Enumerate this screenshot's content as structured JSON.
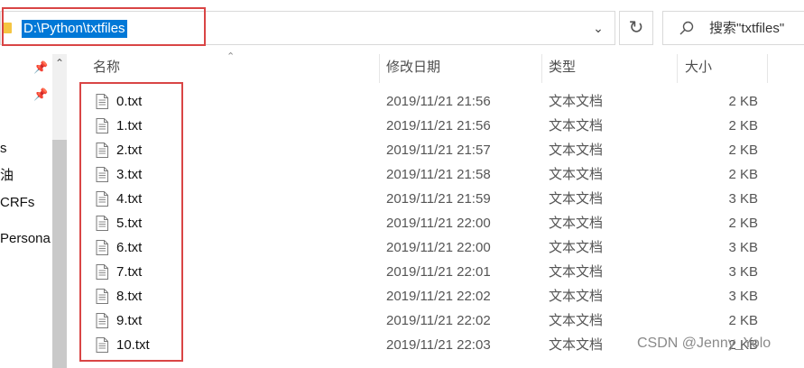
{
  "address": {
    "path": "D:\\Python\\txtfiles"
  },
  "search": {
    "label": "搜索\"txtfiles\""
  },
  "nav": {
    "items": [
      "s",
      "油",
      "CRFs",
      "Persona"
    ]
  },
  "columns": {
    "name": "名称",
    "date": "修改日期",
    "type": "类型",
    "size": "大小"
  },
  "files": [
    {
      "name": "0.txt",
      "date": "2019/11/21 21:56",
      "type": "文本文档",
      "size": "2 KB"
    },
    {
      "name": "1.txt",
      "date": "2019/11/21 21:56",
      "type": "文本文档",
      "size": "2 KB"
    },
    {
      "name": "2.txt",
      "date": "2019/11/21 21:57",
      "type": "文本文档",
      "size": "2 KB"
    },
    {
      "name": "3.txt",
      "date": "2019/11/21 21:58",
      "type": "文本文档",
      "size": "2 KB"
    },
    {
      "name": "4.txt",
      "date": "2019/11/21 21:59",
      "type": "文本文档",
      "size": "3 KB"
    },
    {
      "name": "5.txt",
      "date": "2019/11/21 22:00",
      "type": "文本文档",
      "size": "2 KB"
    },
    {
      "name": "6.txt",
      "date": "2019/11/21 22:00",
      "type": "文本文档",
      "size": "3 KB"
    },
    {
      "name": "7.txt",
      "date": "2019/11/21 22:01",
      "type": "文本文档",
      "size": "3 KB"
    },
    {
      "name": "8.txt",
      "date": "2019/11/21 22:02",
      "type": "文本文档",
      "size": "3 KB"
    },
    {
      "name": "9.txt",
      "date": "2019/11/21 22:02",
      "type": "文本文档",
      "size": "2 KB"
    },
    {
      "name": "10.txt",
      "date": "2019/11/21 22:03",
      "type": "文本文档",
      "size": "2 KB"
    }
  ],
  "watermark": "CSDN @Jenny_Yolo",
  "colors": {
    "selection": "#0078d7",
    "highlight_box": "#d94545"
  }
}
